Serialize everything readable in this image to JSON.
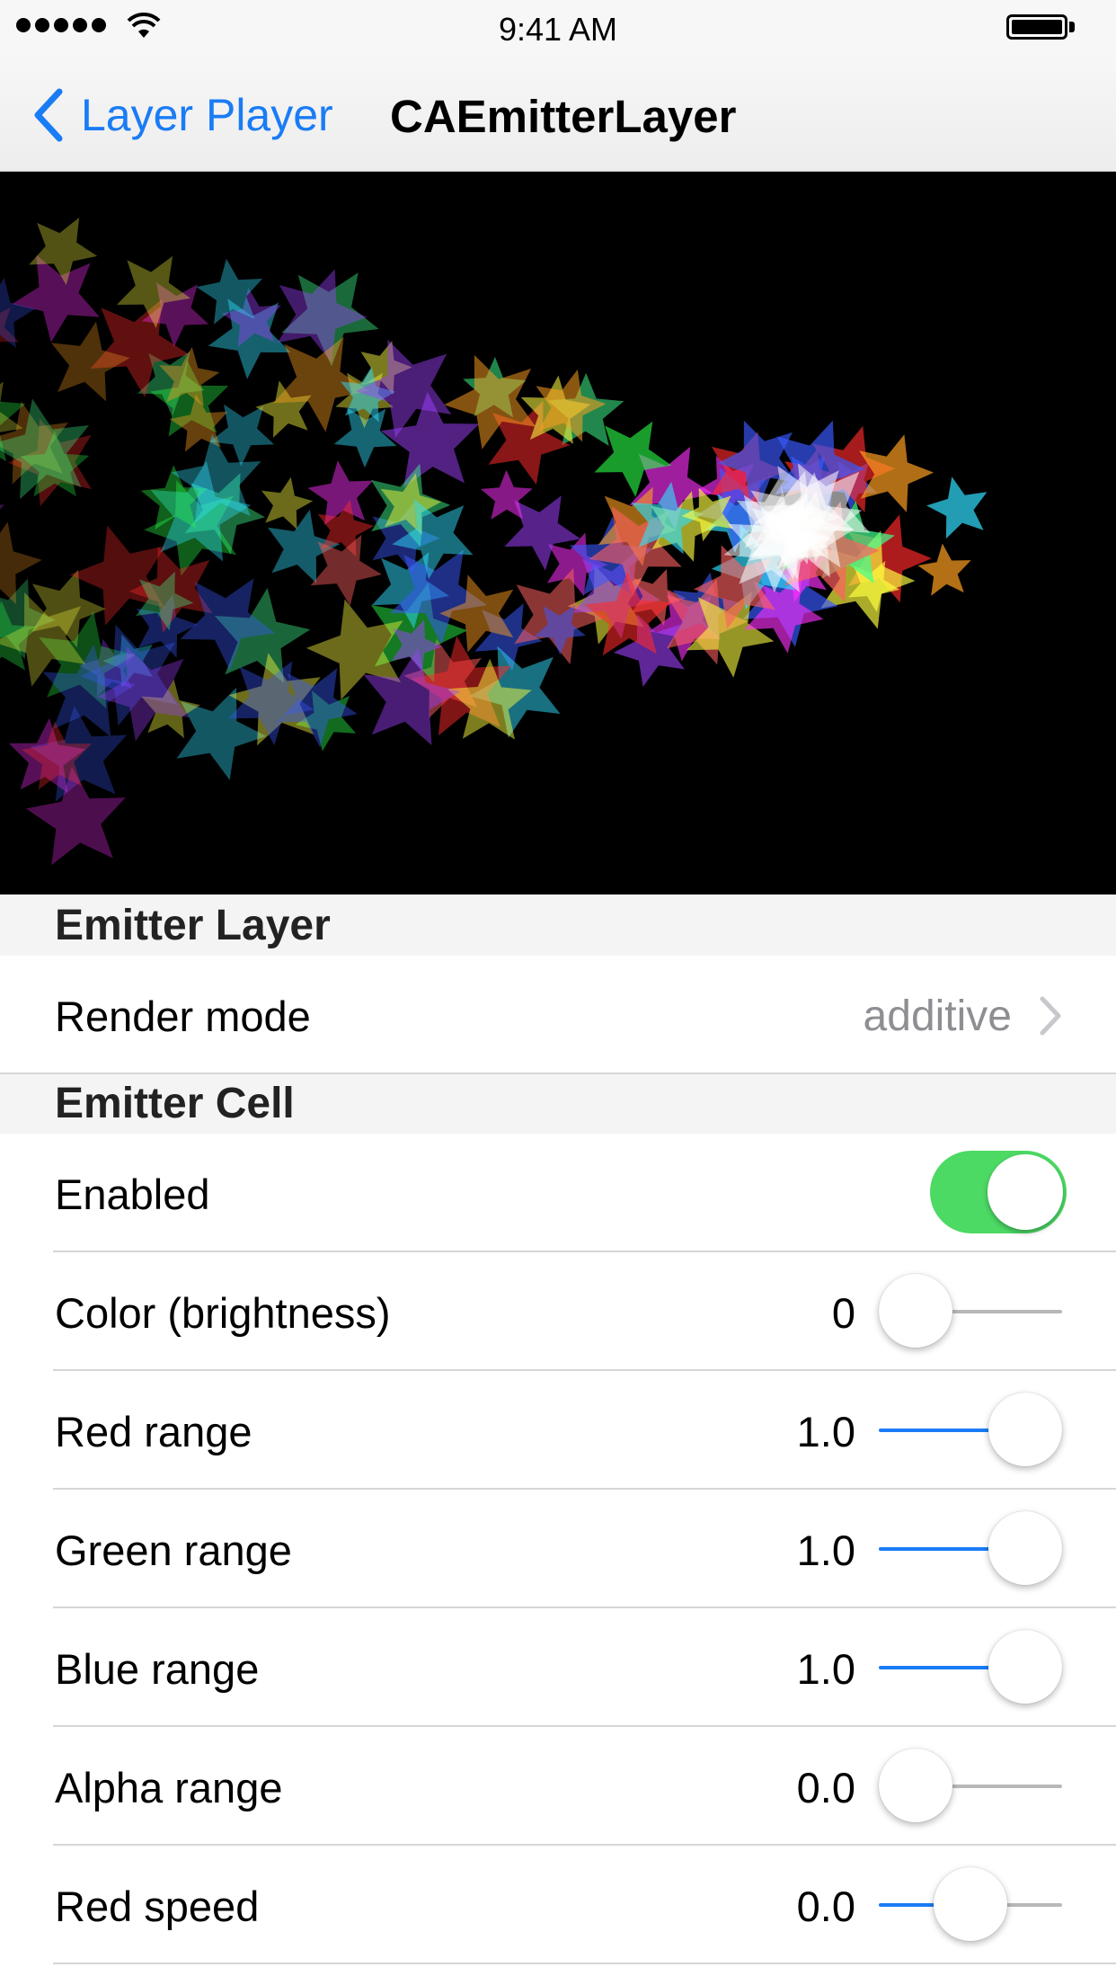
{
  "status_bar": {
    "time": "9:41 AM"
  },
  "nav": {
    "back_label": "Layer Player",
    "title": "CAEmitterLayer"
  },
  "sections": {
    "emitter_layer": {
      "title": "Emitter Layer",
      "render_mode_label": "Render mode",
      "render_mode_value": "additive"
    },
    "emitter_cell": {
      "title": "Emitter Cell",
      "enabled_label": "Enabled",
      "enabled": true,
      "rows": [
        {
          "label": "Color (brightness)",
          "value": "0",
          "fraction": 0.0
        },
        {
          "label": "Red range",
          "value": "1.0",
          "fraction": 1.0
        },
        {
          "label": "Green range",
          "value": "1.0",
          "fraction": 1.0
        },
        {
          "label": "Blue range",
          "value": "1.0",
          "fraction": 1.0
        },
        {
          "label": "Alpha range",
          "value": "0.0",
          "fraction": 0.0
        },
        {
          "label": "Red speed",
          "value": "0.0",
          "fraction": 0.5
        }
      ]
    }
  },
  "colors": {
    "accent_blue": "#1a7cf5",
    "toggle_on_green": "#4cd964",
    "preview_background": "#000000"
  },
  "icons": {
    "back": "chevron-left-icon",
    "disclosure": "chevron-right-icon"
  }
}
